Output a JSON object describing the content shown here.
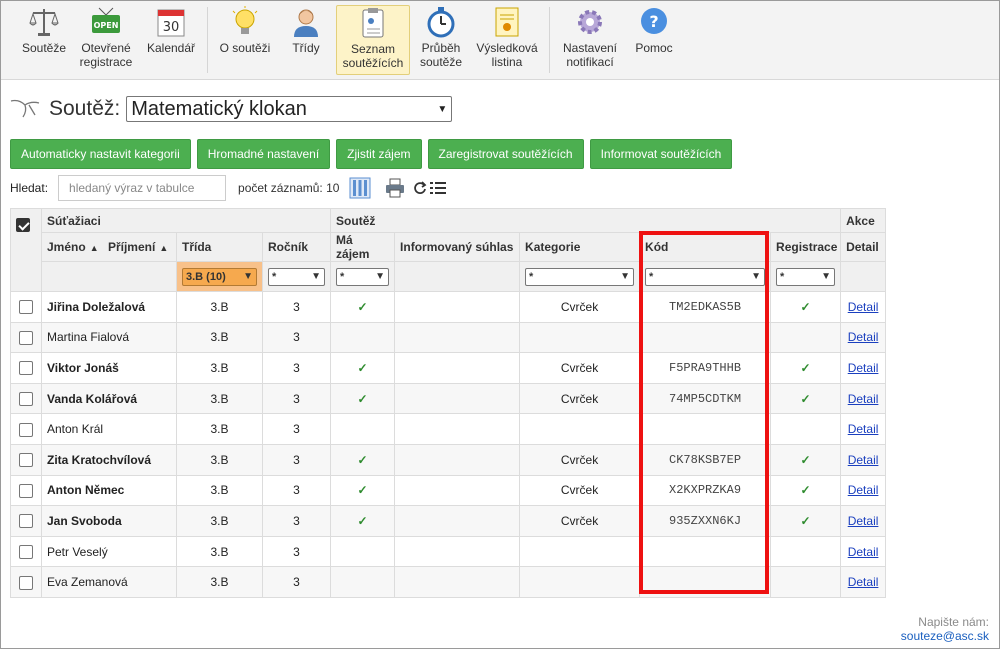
{
  "toolbar": {
    "items": [
      {
        "label": "Soutěže",
        "icon": "scales-icon"
      },
      {
        "label": "Otevřené\nregistrace",
        "icon": "open-sign-icon"
      },
      {
        "label": "Kalendář",
        "icon": "calendar-icon",
        "badge": "30"
      },
      {
        "label": "O soutěži",
        "icon": "lightbulb-icon"
      },
      {
        "label": "Třídy",
        "icon": "student-icon"
      },
      {
        "label": "Seznam\nsoutěžících",
        "icon": "clipboard-icon"
      },
      {
        "label": "Průběh\nsoutěže",
        "icon": "stopwatch-icon"
      },
      {
        "label": "Výsledková\nlistina",
        "icon": "certificate-icon"
      },
      {
        "label": "Nastavení\nnotifikací",
        "icon": "gear-icon"
      },
      {
        "label": "Pomoc",
        "icon": "help-icon"
      }
    ],
    "open_badge": "OPEN",
    "active_index": 5
  },
  "competition": {
    "label": "Soutěž:",
    "selected": "Matematický klokan"
  },
  "actions": [
    "Automaticky nastavit kategorii",
    "Hromadné nastavení",
    "Zjistit zájem",
    "Zaregistrovat soutěžících",
    "Informovat soutěžících"
  ],
  "search": {
    "label": "Hledat:",
    "placeholder": "hledaný výraz v tabulce",
    "count_label": "počet záznamů: 10"
  },
  "table": {
    "groups": {
      "students": "Súťažiaci",
      "competition": "Soutěž",
      "actions": "Akce"
    },
    "headers": {
      "name": "Jméno",
      "surname": "Příjmení",
      "class": "Třída",
      "year": "Ročník",
      "interest": "Má zájem",
      "consent": "Informovaný súhlas",
      "category": "Kategorie",
      "code": "Kód",
      "registration": "Registrace",
      "detail": "Detail"
    },
    "filters": {
      "class": "3.B (10)",
      "year": "*",
      "interest": "*",
      "category": "*",
      "code": "*",
      "registration": "*"
    },
    "detail_link": "Detail",
    "rows": [
      {
        "name": "Jiřina Doležalová",
        "class": "3.B",
        "year": "3",
        "interest": "✓",
        "category": "Cvrček",
        "code": "TM2EDKAS5B",
        "registration": "✓",
        "bold": true
      },
      {
        "name": "Martina Fialová",
        "class": "3.B",
        "year": "3",
        "interest": "",
        "category": "",
        "code": "",
        "registration": "",
        "bold": false
      },
      {
        "name": "Viktor Jonáš",
        "class": "3.B",
        "year": "3",
        "interest": "✓",
        "category": "Cvrček",
        "code": "F5PRA9THHB",
        "registration": "✓",
        "bold": true
      },
      {
        "name": "Vanda Kolářová",
        "class": "3.B",
        "year": "3",
        "interest": "✓",
        "category": "Cvrček",
        "code": "74MP5CDTKM",
        "registration": "✓",
        "bold": true
      },
      {
        "name": "Anton Král",
        "class": "3.B",
        "year": "3",
        "interest": "",
        "category": "",
        "code": "",
        "registration": "",
        "bold": false
      },
      {
        "name": "Zita Kratochvílová",
        "class": "3.B",
        "year": "3",
        "interest": "✓",
        "category": "Cvrček",
        "code": "CK78KSB7EP",
        "registration": "✓",
        "bold": true
      },
      {
        "name": "Anton Němec",
        "class": "3.B",
        "year": "3",
        "interest": "✓",
        "category": "Cvrček",
        "code": "X2KXPRZKA9",
        "registration": "✓",
        "bold": true
      },
      {
        "name": "Jan Svoboda",
        "class": "3.B",
        "year": "3",
        "interest": "✓",
        "category": "Cvrček",
        "code": "935ZXXN6KJ",
        "registration": "✓",
        "bold": true
      },
      {
        "name": "Petr Veselý",
        "class": "3.B",
        "year": "3",
        "interest": "",
        "category": "",
        "code": "",
        "registration": "",
        "bold": false
      },
      {
        "name": "Eva Zemanová",
        "class": "3.B",
        "year": "3",
        "interest": "",
        "category": "",
        "code": "",
        "registration": "",
        "bold": false
      }
    ]
  },
  "footer": {
    "label": "Napište nám:",
    "email": "souteze@asc.sk"
  },
  "colors": {
    "accent_green": "#4caf50",
    "active_tab": "#fdf3c8",
    "class_filter": "#f6a94e",
    "highlight": "#e11111"
  }
}
